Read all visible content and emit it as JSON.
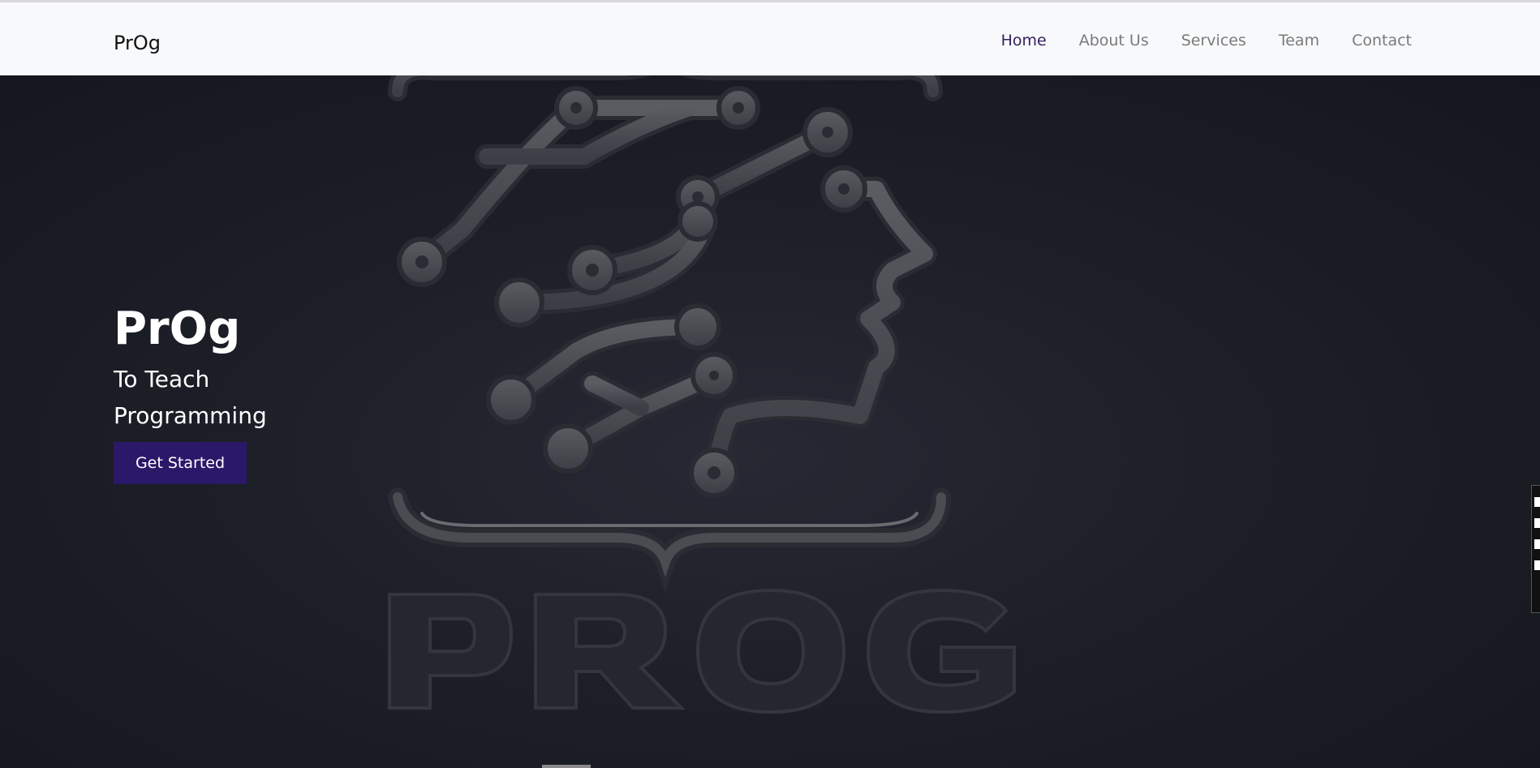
{
  "brand": "PrOg",
  "nav": {
    "items": [
      "Home",
      "About Us",
      "Services",
      "Team",
      "Contact"
    ],
    "active": "Home",
    "active_color": "#34205e"
  },
  "hero": {
    "title": "PrOg",
    "subtitle": "To Teach Programming",
    "cta_label": "Get Started",
    "cta_color": "#2c1869"
  }
}
